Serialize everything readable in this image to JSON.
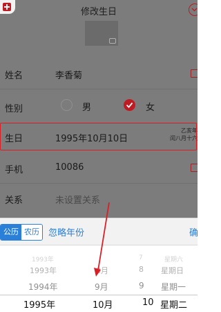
{
  "header": {
    "title": "修改生日"
  },
  "form": {
    "name": {
      "label": "姓名",
      "value": "李香菊"
    },
    "gender": {
      "label": "性别",
      "options": [
        "男",
        "女"
      ],
      "selected": "女"
    },
    "birthday": {
      "label": "生日",
      "value": "1995年10月10日",
      "lunar_line1": "乙亥年",
      "lunar_line2": "闰八月十六"
    },
    "phone": {
      "label": "手机",
      "value": "10086"
    },
    "relation": {
      "label": "关系",
      "placeholder": "未设置关系"
    }
  },
  "toolbar": {
    "calendar_tabs": [
      "公历",
      "农历"
    ],
    "active_tab": "公历",
    "ignore_year": "忽略年份",
    "confirm": "确"
  },
  "picker": {
    "years": [
      "1993年",
      "1994年",
      "1995年"
    ],
    "months": [
      "8月",
      "9月",
      "10月"
    ],
    "days": [
      "7",
      "8",
      "9",
      "10"
    ],
    "weekdays": [
      "星期六",
      "星期日",
      "星期一",
      "星期二"
    ]
  },
  "colors": {
    "brand_red": "#c01a23",
    "accent_blue": "#2a7fd8",
    "annotation_red": "#d81f26"
  }
}
